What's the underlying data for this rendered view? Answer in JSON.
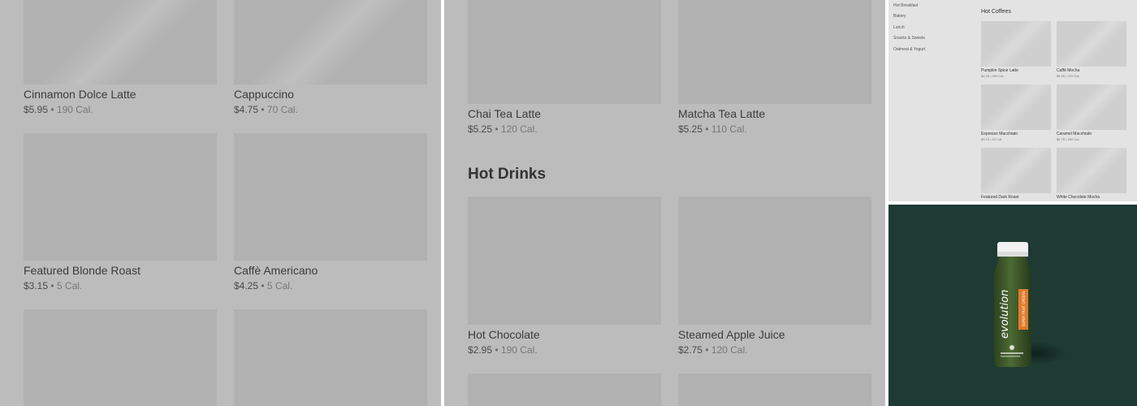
{
  "panel1": {
    "items": [
      {
        "name": "Cinnamon Dolce Latte",
        "price": "$5.95",
        "calories": "190 Cal."
      },
      {
        "name": "Cappuccino",
        "price": "$4.75",
        "calories": "70 Cal."
      },
      {
        "name": "Featured Blonde Roast",
        "price": "$3.15",
        "calories": "5 Cal."
      },
      {
        "name": "Caffè Americano",
        "price": "$4.25",
        "calories": "5 Cal."
      }
    ]
  },
  "panel2": {
    "section_title": "Hot Drinks",
    "items": [
      {
        "name": "Chai Tea Latte",
        "price": "$5.25",
        "calories": "120 Cal."
      },
      {
        "name": "Matcha Tea Latte",
        "price": "$5.25",
        "calories": "110 Cal."
      },
      {
        "name": "Hot Chocolate",
        "price": "$2.95",
        "calories": "190 Cal."
      },
      {
        "name": "Steamed Apple Juice",
        "price": "$2.75",
        "calories": "120 Cal."
      }
    ]
  },
  "panel3": {
    "sidebar": [
      "Hot Breakfast",
      "Bakery",
      "Lunch",
      "Snacks & Sweets",
      "Oatmeal & Yogurt"
    ],
    "section_title": "Hot Coffees",
    "items": [
      {
        "name": "Pumpkin Spice Latte",
        "meta": "$6.25 • 390 Cal."
      },
      {
        "name": "Caffè Mocha",
        "meta": "$5.45 • 370 Cal."
      },
      {
        "name": "Espresso Macchiato",
        "meta": "$3.15 • 10 Cal."
      },
      {
        "name": "Caramel Macchiato",
        "meta": "$5.75 • 250 Cal."
      },
      {
        "name": "Featured Dark Roast",
        "meta": ""
      },
      {
        "name": "White Chocolate Mocha",
        "meta": ""
      }
    ]
  },
  "panel4": {
    "product_brand": "evolution",
    "product_label": "SUPER FRUIT GREENS"
  },
  "colors": {
    "overlay_grey": "#bcbcbc",
    "tile_grey": "#b1b1b1",
    "photo_background": "#1e3a33",
    "bottle_green": "#3f5a2c",
    "label_orange": "#e07a2c"
  }
}
